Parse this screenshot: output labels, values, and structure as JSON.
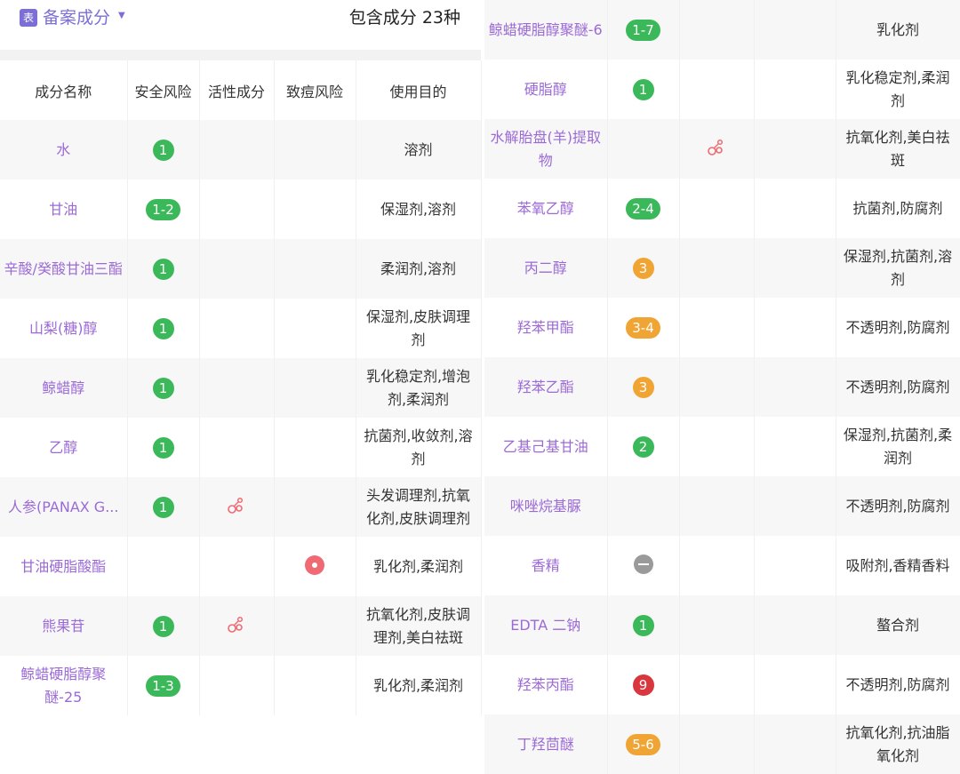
{
  "header": {
    "tag": "表",
    "title": "备案成分",
    "count_text": "包含成分 23种"
  },
  "columns": [
    "成分名称",
    "安全风险",
    "活性成分",
    "致痘风险",
    "使用目的"
  ],
  "colors": {
    "accent": "#7b6fd6",
    "name_text": "#9b6ad6",
    "risk_low": "#3bb85a",
    "risk_mid": "#f0a433",
    "risk_high": "#d9363e",
    "risk_unknown": "#a8a8a8",
    "acne": "#ef6a72"
  },
  "left_rows": [
    {
      "name": "水",
      "risk": "1",
      "risk_level": "green",
      "active": false,
      "acne": false,
      "purpose": "溶剂"
    },
    {
      "name": "甘油",
      "risk": "1-2",
      "risk_level": "green",
      "active": false,
      "acne": false,
      "purpose": "保湿剂,溶剂"
    },
    {
      "name": "辛酸/癸酸甘油三酯",
      "risk": "1",
      "risk_level": "green",
      "active": false,
      "acne": false,
      "purpose": "柔润剂,溶剂"
    },
    {
      "name": "山梨(糖)醇",
      "risk": "1",
      "risk_level": "green",
      "active": false,
      "acne": false,
      "purpose": "保湿剂,皮肤调理剂"
    },
    {
      "name": "鲸蜡醇",
      "risk": "1",
      "risk_level": "green",
      "active": false,
      "acne": false,
      "purpose": "乳化稳定剂,增泡剂,柔润剂"
    },
    {
      "name": "乙醇",
      "risk": "1",
      "risk_level": "green",
      "active": false,
      "acne": false,
      "purpose": "抗菌剂,收敛剂,溶剂"
    },
    {
      "name": "人参(PANAX G...",
      "risk": "1",
      "risk_level": "green",
      "active": true,
      "acne": false,
      "purpose": "头发调理剂,抗氧化剂,皮肤调理剂"
    },
    {
      "name": "甘油硬脂酸酯",
      "risk": "",
      "risk_level": "none",
      "active": false,
      "acne": true,
      "purpose": "乳化剂,柔润剂"
    },
    {
      "name": "熊果苷",
      "risk": "1",
      "risk_level": "green",
      "active": true,
      "acne": false,
      "purpose": "抗氧化剂,皮肤调理剂,美白祛斑"
    },
    {
      "name": "鲸蜡硬脂醇聚醚-25",
      "risk": "1-3",
      "risk_level": "green",
      "active": false,
      "acne": false,
      "purpose": "乳化剂,柔润剂"
    }
  ],
  "right_rows": [
    {
      "name": "鲸蜡硬脂醇聚醚-6",
      "risk": "1-7",
      "risk_level": "green",
      "active": false,
      "acne": false,
      "purpose": "乳化剂"
    },
    {
      "name": "硬脂醇",
      "risk": "1",
      "risk_level": "green",
      "active": false,
      "acne": false,
      "purpose": "乳化稳定剂,柔润剂"
    },
    {
      "name": "水解胎盘(羊)提取物",
      "risk": "",
      "risk_level": "none",
      "active": true,
      "acne": false,
      "purpose": "抗氧化剂,美白祛斑"
    },
    {
      "name": "苯氧乙醇",
      "risk": "2-4",
      "risk_level": "green",
      "active": false,
      "acne": false,
      "purpose": "抗菌剂,防腐剂"
    },
    {
      "name": "丙二醇",
      "risk": "3",
      "risk_level": "orange",
      "active": false,
      "acne": false,
      "purpose": "保湿剂,抗菌剂,溶剂"
    },
    {
      "name": "羟苯甲酯",
      "risk": "3-4",
      "risk_level": "orange",
      "active": false,
      "acne": false,
      "purpose": "不透明剂,防腐剂"
    },
    {
      "name": "羟苯乙酯",
      "risk": "3",
      "risk_level": "orange",
      "active": false,
      "acne": false,
      "purpose": "不透明剂,防腐剂"
    },
    {
      "name": "乙基己基甘油",
      "risk": "2",
      "risk_level": "green",
      "active": false,
      "acne": false,
      "purpose": "保湿剂,抗菌剂,柔润剂"
    },
    {
      "name": "咪唑烷基脲",
      "risk": "",
      "risk_level": "none",
      "active": false,
      "acne": false,
      "purpose": "不透明剂,防腐剂"
    },
    {
      "name": "香精",
      "risk": "",
      "risk_level": "unknown",
      "active": false,
      "acne": false,
      "purpose": "吸附剂,香精香料"
    },
    {
      "name": "EDTA 二钠",
      "risk": "1",
      "risk_level": "green",
      "active": false,
      "acne": false,
      "purpose": "螯合剂"
    },
    {
      "name": "羟苯丙酯",
      "risk": "9",
      "risk_level": "red",
      "active": false,
      "acne": false,
      "purpose": "不透明剂,防腐剂"
    },
    {
      "name": "丁羟茴醚",
      "risk": "5-6",
      "risk_level": "orange",
      "active": false,
      "acne": false,
      "purpose": "抗氧化剂,抗油脂氧化剂"
    }
  ]
}
